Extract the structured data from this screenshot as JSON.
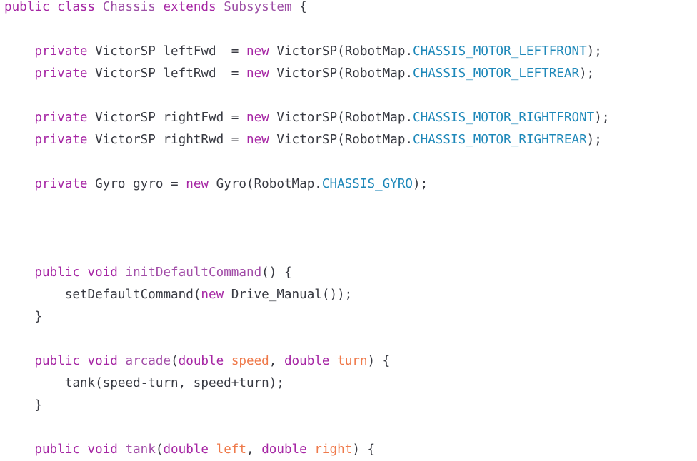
{
  "code": {
    "lines": [
      [
        {
          "t": "public",
          "c": "kw"
        },
        {
          "t": " ",
          "c": "plain"
        },
        {
          "t": "class",
          "c": "kw"
        },
        {
          "t": " ",
          "c": "plain"
        },
        {
          "t": "Chassis",
          "c": "cls"
        },
        {
          "t": " ",
          "c": "plain"
        },
        {
          "t": "extends",
          "c": "kw"
        },
        {
          "t": " ",
          "c": "plain"
        },
        {
          "t": "Subsystem",
          "c": "cls"
        },
        {
          "t": " {",
          "c": "plain"
        }
      ],
      [],
      [
        {
          "t": "    ",
          "c": "plain"
        },
        {
          "t": "private",
          "c": "kw"
        },
        {
          "t": " VictorSP leftFwd  = ",
          "c": "plain"
        },
        {
          "t": "new",
          "c": "kw"
        },
        {
          "t": " VictorSP(RobotMap.",
          "c": "plain"
        },
        {
          "t": "CHASSIS_MOTOR_LEFTFRONT",
          "c": "const"
        },
        {
          "t": ");",
          "c": "plain"
        }
      ],
      [
        {
          "t": "    ",
          "c": "plain"
        },
        {
          "t": "private",
          "c": "kw"
        },
        {
          "t": " VictorSP leftRwd  = ",
          "c": "plain"
        },
        {
          "t": "new",
          "c": "kw"
        },
        {
          "t": " VictorSP(RobotMap.",
          "c": "plain"
        },
        {
          "t": "CHASSIS_MOTOR_LEFTREAR",
          "c": "const"
        },
        {
          "t": ");",
          "c": "plain"
        }
      ],
      [],
      [
        {
          "t": "    ",
          "c": "plain"
        },
        {
          "t": "private",
          "c": "kw"
        },
        {
          "t": " VictorSP rightFwd = ",
          "c": "plain"
        },
        {
          "t": "new",
          "c": "kw"
        },
        {
          "t": " VictorSP(RobotMap.",
          "c": "plain"
        },
        {
          "t": "CHASSIS_MOTOR_RIGHTFRONT",
          "c": "const"
        },
        {
          "t": ");",
          "c": "plain"
        }
      ],
      [
        {
          "t": "    ",
          "c": "plain"
        },
        {
          "t": "private",
          "c": "kw"
        },
        {
          "t": " VictorSP rightRwd = ",
          "c": "plain"
        },
        {
          "t": "new",
          "c": "kw"
        },
        {
          "t": " VictorSP(RobotMap.",
          "c": "plain"
        },
        {
          "t": "CHASSIS_MOTOR_RIGHTREAR",
          "c": "const"
        },
        {
          "t": ");",
          "c": "plain"
        }
      ],
      [],
      [
        {
          "t": "    ",
          "c": "plain"
        },
        {
          "t": "private",
          "c": "kw"
        },
        {
          "t": " Gyro gyro = ",
          "c": "plain"
        },
        {
          "t": "new",
          "c": "kw"
        },
        {
          "t": " Gyro(RobotMap.",
          "c": "plain"
        },
        {
          "t": "CHASSIS_GYRO",
          "c": "const"
        },
        {
          "t": ");",
          "c": "plain"
        }
      ],
      [],
      [],
      [],
      [
        {
          "t": "    ",
          "c": "plain"
        },
        {
          "t": "public",
          "c": "kw"
        },
        {
          "t": " ",
          "c": "plain"
        },
        {
          "t": "void",
          "c": "kw"
        },
        {
          "t": " ",
          "c": "plain"
        },
        {
          "t": "initDefaultCommand",
          "c": "fn"
        },
        {
          "t": "() {",
          "c": "plain"
        }
      ],
      [
        {
          "t": "        setDefaultCommand(",
          "c": "plain"
        },
        {
          "t": "new",
          "c": "kw"
        },
        {
          "t": " Drive_Manual());",
          "c": "plain"
        }
      ],
      [
        {
          "t": "    }",
          "c": "plain"
        }
      ],
      [],
      [
        {
          "t": "    ",
          "c": "plain"
        },
        {
          "t": "public",
          "c": "kw"
        },
        {
          "t": " ",
          "c": "plain"
        },
        {
          "t": "void",
          "c": "kw"
        },
        {
          "t": " ",
          "c": "plain"
        },
        {
          "t": "arcade",
          "c": "fn"
        },
        {
          "t": "(",
          "c": "plain"
        },
        {
          "t": "double",
          "c": "kw"
        },
        {
          "t": " ",
          "c": "plain"
        },
        {
          "t": "speed",
          "c": "param"
        },
        {
          "t": ", ",
          "c": "plain"
        },
        {
          "t": "double",
          "c": "kw"
        },
        {
          "t": " ",
          "c": "plain"
        },
        {
          "t": "turn",
          "c": "param"
        },
        {
          "t": ") {",
          "c": "plain"
        }
      ],
      [
        {
          "t": "        tank(speed-turn, speed+turn);",
          "c": "plain"
        }
      ],
      [
        {
          "t": "    }",
          "c": "plain"
        }
      ],
      [],
      [
        {
          "t": "    ",
          "c": "plain"
        },
        {
          "t": "public",
          "c": "kw"
        },
        {
          "t": " ",
          "c": "plain"
        },
        {
          "t": "void",
          "c": "kw"
        },
        {
          "t": " ",
          "c": "plain"
        },
        {
          "t": "tank",
          "c": "fn"
        },
        {
          "t": "(",
          "c": "plain"
        },
        {
          "t": "double",
          "c": "kw"
        },
        {
          "t": " ",
          "c": "plain"
        },
        {
          "t": "left",
          "c": "param"
        },
        {
          "t": ", ",
          "c": "plain"
        },
        {
          "t": "double",
          "c": "kw"
        },
        {
          "t": " ",
          "c": "plain"
        },
        {
          "t": "right",
          "c": "param"
        },
        {
          "t": ") {",
          "c": "plain"
        }
      ]
    ]
  }
}
